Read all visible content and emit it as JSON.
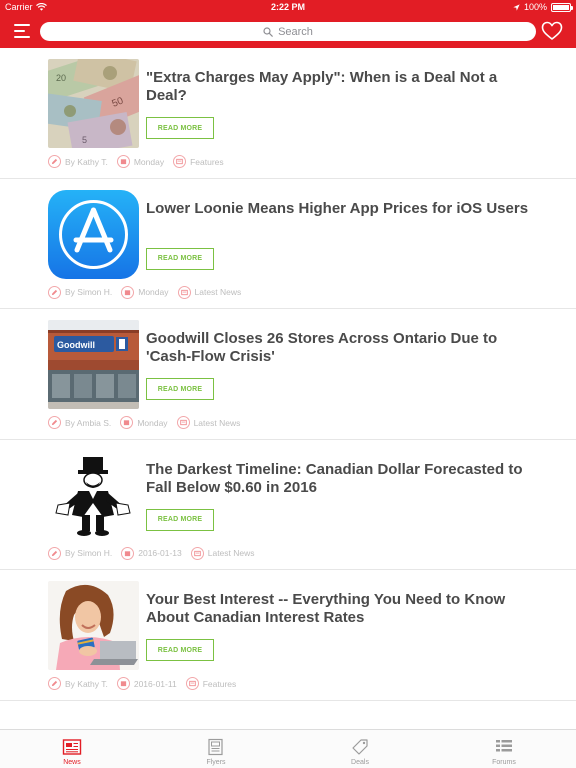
{
  "status_bar": {
    "carrier": "Carrier",
    "time": "2:22 PM",
    "battery": "100%"
  },
  "nav": {
    "search_placeholder": "Search"
  },
  "colors": {
    "brand_red": "#e21d25",
    "accent_green": "#7bc142",
    "title_gray": "#4a4a4a"
  },
  "articles": [
    {
      "title": "\"Extra Charges May Apply\": When is a Deal Not a Deal?",
      "button": "READ MORE",
      "author": "By Kathy T.",
      "date": "Monday",
      "category": "Features",
      "thumbnail": "canadian-banknotes-image"
    },
    {
      "title": "Lower Loonie Means Higher App Prices for iOS Users",
      "button": "READ MORE",
      "author": "By Simon H.",
      "date": "Monday",
      "category": "Latest News",
      "thumbnail": "app-store-icon"
    },
    {
      "title": "Goodwill Closes 26 Stores Across Ontario Due to 'Cash-Flow Crisis'",
      "button": "READ MORE",
      "author": "By Ambia S.",
      "date": "Monday",
      "category": "Latest News",
      "thumbnail": "goodwill-storefront-image",
      "thumbnail_sign": "Goodwill"
    },
    {
      "title": "The Darkest Timeline: Canadian Dollar Forecasted to Fall Below $0.60 in 2016",
      "button": "READ MORE",
      "author": "By Simon H.",
      "date": "2016-01-13",
      "category": "Latest News",
      "thumbnail": "monopoly-man-empty-pockets-image"
    },
    {
      "title": "Your Best Interest -- Everything You Need to Know About Canadian Interest Rates",
      "button": "READ MORE",
      "author": "By Kathy T.",
      "date": "2016-01-11",
      "category": "Features",
      "thumbnail": "woman-with-credit-card-laptop-image"
    }
  ],
  "tabs": [
    {
      "label": "News",
      "icon": "newspaper-icon",
      "active": true
    },
    {
      "label": "Flyers",
      "icon": "flyers-icon",
      "active": false
    },
    {
      "label": "Deals",
      "icon": "price-tag-icon",
      "active": false
    },
    {
      "label": "Forums",
      "icon": "forums-list-icon",
      "active": false
    }
  ]
}
